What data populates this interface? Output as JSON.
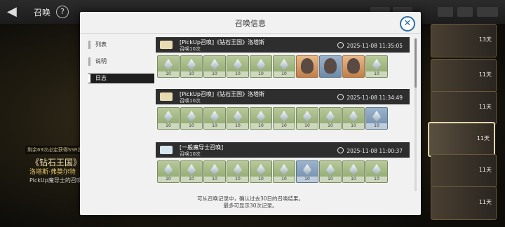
{
  "topbar": {
    "title": "召唤",
    "help_label": "?"
  },
  "banner": {
    "note": "剩余69次必定获得SSR魔",
    "title": "《钻石王国》",
    "hero_name": "洛塔斯·弗莫尔特",
    "desc": "PickUp魔导士的召唤机"
  },
  "right_cards": [
    {
      "days": "13天"
    },
    {
      "days": "11天"
    },
    {
      "days": "11天"
    },
    {
      "days": "11天"
    },
    {
      "days": "11天"
    },
    {
      "days": "11天"
    }
  ],
  "dialog": {
    "title": "召唤信息",
    "close_label": "✕",
    "sidebar": [
      {
        "label": "列表",
        "active": false
      },
      {
        "label": "说明",
        "active": false
      },
      {
        "label": "日志",
        "active": true
      }
    ],
    "records": [
      {
        "name": "[PickUp召唤]《钻石王国》洛塔斯",
        "sub": "召唤10次",
        "time": "2025-11-08 11:35:05",
        "ticket": "gold",
        "items": [
          {
            "type": "crystal",
            "qty": "10"
          },
          {
            "type": "crystal",
            "qty": "10"
          },
          {
            "type": "crystal",
            "qty": "10"
          },
          {
            "type": "crystal",
            "qty": "10"
          },
          {
            "type": "crystal",
            "qty": "10"
          },
          {
            "type": "crystal",
            "qty": "10"
          },
          {
            "type": "portrait",
            "color": "orange"
          },
          {
            "type": "portrait",
            "color": "blue"
          },
          {
            "type": "portrait",
            "color": "orange"
          },
          {
            "type": "crystal",
            "qty": "10"
          }
        ]
      },
      {
        "name": "[PickUp召唤]《钻石王国》洛塔斯",
        "sub": "召唤10次",
        "time": "2025-11-08 11:34:49",
        "ticket": "gold",
        "items": [
          {
            "type": "crystal",
            "qty": "10"
          },
          {
            "type": "crystal",
            "qty": "10"
          },
          {
            "type": "crystal",
            "qty": "10"
          },
          {
            "type": "crystal",
            "qty": "10"
          },
          {
            "type": "crystal",
            "qty": "10"
          },
          {
            "type": "crystal",
            "qty": "10"
          },
          {
            "type": "crystal",
            "qty": "10"
          },
          {
            "type": "crystal",
            "qty": "10"
          },
          {
            "type": "crystal",
            "qty": "10"
          },
          {
            "type": "crystal",
            "qty": "10",
            "color": "blue"
          }
        ]
      },
      {
        "name": "[一般魔导士召唤]",
        "sub": "召唤10次",
        "time": "2025-11-08 11:00:37",
        "ticket": "blue",
        "items": [
          {
            "type": "crystal",
            "qty": "10"
          },
          {
            "type": "crystal",
            "qty": "10"
          },
          {
            "type": "crystal",
            "qty": "10"
          },
          {
            "type": "crystal",
            "qty": "10"
          },
          {
            "type": "crystal",
            "qty": "10"
          },
          {
            "type": "crystal",
            "qty": "10"
          },
          {
            "type": "crystal",
            "qty": "10",
            "color": "blue"
          },
          {
            "type": "crystal",
            "qty": "10"
          },
          {
            "type": "crystal",
            "qty": "10"
          },
          {
            "type": "crystal",
            "qty": "10"
          }
        ]
      }
    ],
    "footer_line1": "可从召唤记录中，确认过去30日的召唤结果。",
    "footer_line2": "最多可显示30次记录。"
  }
}
